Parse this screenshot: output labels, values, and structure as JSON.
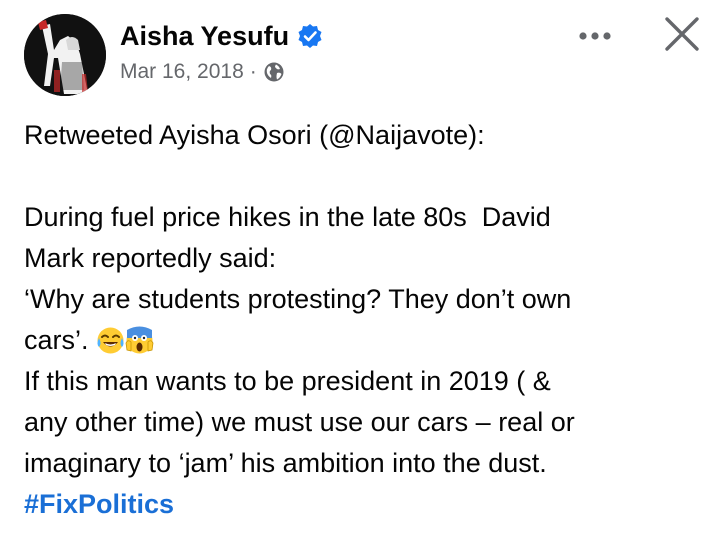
{
  "post": {
    "author": "Aisha Yesufu",
    "date": "Mar 16, 2018",
    "meta_separator": "·",
    "icons": {
      "verified": "verified-badge-icon",
      "audience": "globe-icon",
      "more": "more-options-icon",
      "close": "close-icon"
    },
    "colors": {
      "verified_blue": "#1877f2",
      "hashtag_blue": "#1a6fd6",
      "meta_gray": "#65676b"
    },
    "body": {
      "retweet_line": "Retweeted Ayisha Osori (@Naijavote):",
      "line_1": "During fuel price hikes in the late 80s  David",
      "line_2": "Mark reportedly said:",
      "line_3": "‘Why are students protesting? They don’t own",
      "line_4": "cars’.",
      "line_5": "If this man wants to be president in 2019 ( &",
      "line_6": "any other time) we must use our cars – real or",
      "line_7": "imaginary to ‘jam’ his ambition into the dust.",
      "hashtag": "#FixPolitics",
      "emojis": [
        "laughing-tears-emoji",
        "screaming-face-emoji"
      ]
    }
  }
}
